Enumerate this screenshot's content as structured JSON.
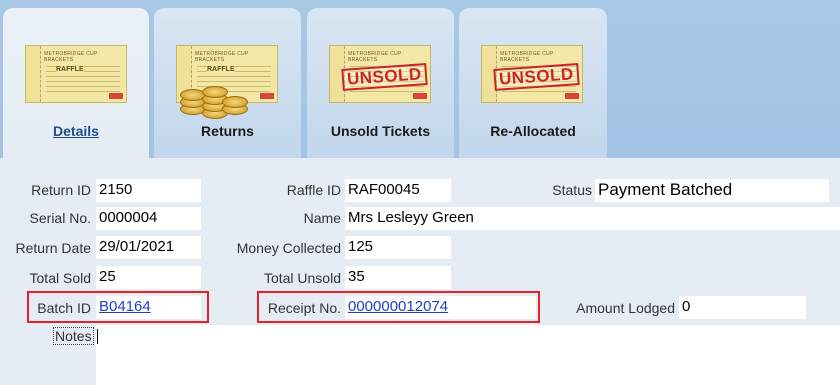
{
  "tabs": [
    {
      "label": "Details",
      "image": "raffle-ticket-icon",
      "active": true
    },
    {
      "label": "Returns",
      "image": "raffle-ticket-coins-icon",
      "active": false
    },
    {
      "label": "Unsold Tickets",
      "image": "unsold-ticket-icon",
      "active": false
    },
    {
      "label": "Re-Allocated",
      "image": "unsold-ticket-icon",
      "active": false
    }
  ],
  "ticket_art": {
    "heading": "METROBRIDGE CUP BRACKETS",
    "raffle_word": "RAFFLE",
    "stamp": "UNSOLD"
  },
  "fields": {
    "return_id": {
      "label": "Return ID",
      "value": "2150"
    },
    "serial_no": {
      "label": "Serial No.",
      "value": "0000004"
    },
    "return_date": {
      "label": "Return Date",
      "value": "29/01/2021"
    },
    "total_sold": {
      "label": "Total Sold",
      "value": "25"
    },
    "batch_id": {
      "label": "Batch ID",
      "value": "B04164"
    },
    "raffle_id": {
      "label": "Raffle ID",
      "value": "RAF00045"
    },
    "name": {
      "label": "Name",
      "value": "Mrs Lesleyy Green"
    },
    "money_collected": {
      "label": "Money Collected",
      "value": "125"
    },
    "total_unsold": {
      "label": "Total Unsold",
      "value": "35"
    },
    "receipt_no": {
      "label": "Receipt No.",
      "value": "000000012074"
    },
    "status": {
      "label": "Status",
      "value": "Payment Batched"
    },
    "amount_lodged": {
      "label": "Amount Lodged",
      "value": "0"
    },
    "notes": {
      "label": "Notes",
      "value": ""
    }
  },
  "colors": {
    "highlight_box": "#e2232a",
    "link": "#1f3fbf",
    "tab_strip": "#a9c8e6"
  }
}
